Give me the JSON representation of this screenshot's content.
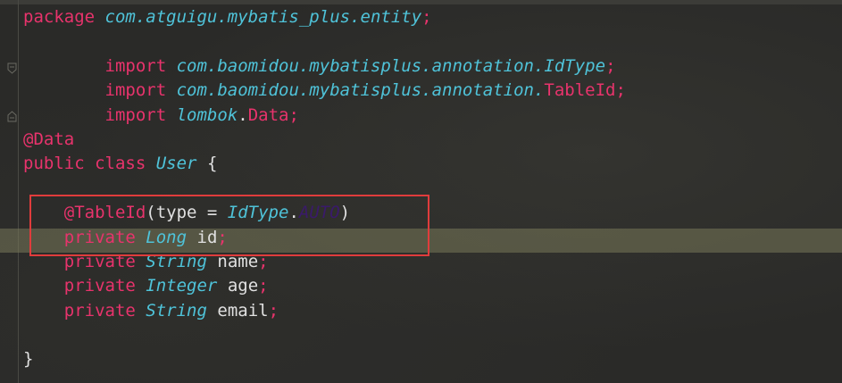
{
  "editor": {
    "lines": [
      {
        "tokens": [
          [
            "kw",
            "package"
          ],
          [
            "pl",
            " "
          ],
          [
            "pk",
            "com.atguigu.mybatis_plus.entity"
          ],
          [
            "sm",
            ";"
          ]
        ]
      },
      {
        "tokens": []
      },
      {
        "tokens": [
          [
            "pl",
            "        "
          ],
          [
            "kw",
            "import"
          ],
          [
            "pl",
            " "
          ],
          [
            "pk",
            "com.baomidou.mybatisplus.annotation."
          ],
          [
            "ty",
            "IdType"
          ],
          [
            "sm",
            ";"
          ]
        ]
      },
      {
        "tokens": [
          [
            "pl",
            "        "
          ],
          [
            "kw",
            "import"
          ],
          [
            "pl",
            " "
          ],
          [
            "pk",
            "com.baomidou.mybatisplus.annotation."
          ],
          [
            "id",
            "TableId"
          ],
          [
            "sm",
            ";"
          ]
        ]
      },
      {
        "tokens": [
          [
            "pl",
            "        "
          ],
          [
            "kw",
            "import"
          ],
          [
            "pl",
            " "
          ],
          [
            "pk",
            "lombok"
          ],
          [
            "pl",
            "."
          ],
          [
            "id",
            "Data"
          ],
          [
            "sm",
            ";"
          ]
        ]
      },
      {
        "tokens": [
          [
            "an",
            "@Data"
          ]
        ]
      },
      {
        "tokens": [
          [
            "kw",
            "public class"
          ],
          [
            "pl",
            " "
          ],
          [
            "ty",
            "User"
          ],
          [
            "pl",
            " {"
          ]
        ]
      },
      {
        "tokens": []
      },
      {
        "tokens": [
          [
            "pl",
            "    "
          ],
          [
            "an",
            "@TableId"
          ],
          [
            "pl",
            "(type = "
          ],
          [
            "ty",
            "IdType"
          ],
          [
            "pl",
            "."
          ],
          [
            "en",
            "AUTO"
          ],
          [
            "pl",
            ")"
          ]
        ]
      },
      {
        "tokens": [
          [
            "pl",
            "    "
          ],
          [
            "kw",
            "private"
          ],
          [
            "pl",
            " "
          ],
          [
            "ty",
            "Long"
          ],
          [
            "pl",
            " id"
          ],
          [
            "sm",
            ";"
          ]
        ]
      },
      {
        "tokens": [
          [
            "pl",
            "    "
          ],
          [
            "kw",
            "private"
          ],
          [
            "pl",
            " "
          ],
          [
            "ty",
            "String"
          ],
          [
            "pl",
            " name"
          ],
          [
            "sm",
            ";"
          ]
        ]
      },
      {
        "tokens": [
          [
            "pl",
            "    "
          ],
          [
            "kw",
            "private"
          ],
          [
            "pl",
            " "
          ],
          [
            "ty",
            "Integer"
          ],
          [
            "pl",
            " age"
          ],
          [
            "sm",
            ";"
          ]
        ]
      },
      {
        "tokens": [
          [
            "pl",
            "    "
          ],
          [
            "kw",
            "private"
          ],
          [
            "pl",
            " "
          ],
          [
            "ty",
            "String"
          ],
          [
            "pl",
            " email"
          ],
          [
            "sm",
            ";"
          ]
        ]
      },
      {
        "tokens": []
      },
      {
        "tokens": [
          [
            "pl",
            "}"
          ]
        ]
      }
    ]
  },
  "colors": {
    "keyword": "#e8336c",
    "type": "#4fc3d9",
    "plain": "#e0e0e0",
    "enum_constant": "#3a1a6a",
    "highlight_border": "#e03c3c",
    "current_line": "#78785a"
  },
  "icons": {
    "fold_open": "fold-open-icon",
    "fold_close": "fold-close-icon"
  }
}
